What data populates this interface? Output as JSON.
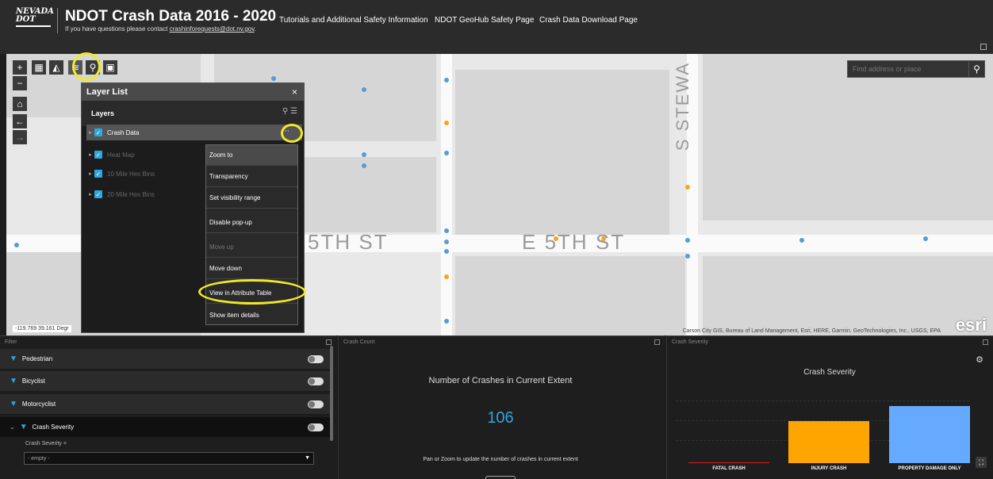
{
  "header": {
    "logo_text": "NEVADA DOT",
    "title": "NDOT Crash Data 2016 - 2020",
    "subtitle_prefix": "If you have questions please contact ",
    "subtitle_email": "crashinforequests@dot.nv.gov",
    "subtitle_suffix": ".",
    "nav": [
      "Tutorials and Additional Safety Information",
      "NDOT GeoHub Safety Page",
      "Crash Data Download Page"
    ]
  },
  "map": {
    "search_placeholder": "Find address or place",
    "road_labels": [
      "S STEWA",
      "5TH ST",
      "E 5TH ST"
    ],
    "attribution": "Carson City GIS, Bureau of Land Management, Esri, HERE, Garmin, GeoTechnologies, Inc., USGS, EPA",
    "esri_logo": "esri",
    "coordinates": "-119.769 39.161 Degr"
  },
  "toolbar": {
    "zoom_in": "+",
    "zoom_out": "−",
    "home_icon": "home-icon",
    "back_icon": "arrow-left-icon",
    "forward_icon": "arrow-right-icon"
  },
  "layer_list": {
    "title": "Layer List",
    "close": "×",
    "subtitle": "Layers",
    "layers": [
      {
        "name": "Crash Data",
        "checked": true,
        "active": true
      },
      {
        "name": "Heat Map",
        "checked": true,
        "active": false
      },
      {
        "name": "10 Mile Hex Bins",
        "checked": true,
        "active": false
      },
      {
        "name": "20 Mile Hex Bins",
        "checked": true,
        "active": false
      }
    ],
    "more_icon": "⋯"
  },
  "context_menu": {
    "items": [
      {
        "label": "Zoom to",
        "disabled": false
      },
      {
        "label": "Transparency",
        "disabled": false
      },
      {
        "label": "Set visibility range",
        "disabled": false
      },
      {
        "label": "Disable pop-up",
        "disabled": false
      },
      {
        "label": "Move up",
        "disabled": true
      },
      {
        "label": "Move down",
        "disabled": false
      },
      {
        "label": "View in Attribute Table",
        "disabled": false
      },
      {
        "label": "Show item details",
        "disabled": false
      }
    ]
  },
  "filter_panel": {
    "title": "Filter",
    "rows": [
      "Pedestrian",
      "Bicyclist",
      "Motorcyclist",
      "Crash Severity"
    ],
    "severity_label": "Crash Severity =",
    "severity_value": "- empty -"
  },
  "count_panel": {
    "title": "Crash Count",
    "heading": "Number of Crashes in Current Extent",
    "value": "106",
    "note": "Pan or Zoom to update the number of crashes in current extent"
  },
  "severity_panel": {
    "title": "Crash Severity",
    "chart_title": "Crash Severity"
  },
  "chart_data": {
    "type": "bar",
    "title": "Crash Severity",
    "categories": [
      "FATAL CRASH",
      "INJURY CRASH",
      "PROPERTY DAMAGE ONLY"
    ],
    "values": [
      1,
      54,
      74
    ],
    "colors": [
      "#e02020",
      "#ffa500",
      "#66aaff"
    ],
    "ylim": [
      0,
      80
    ]
  }
}
